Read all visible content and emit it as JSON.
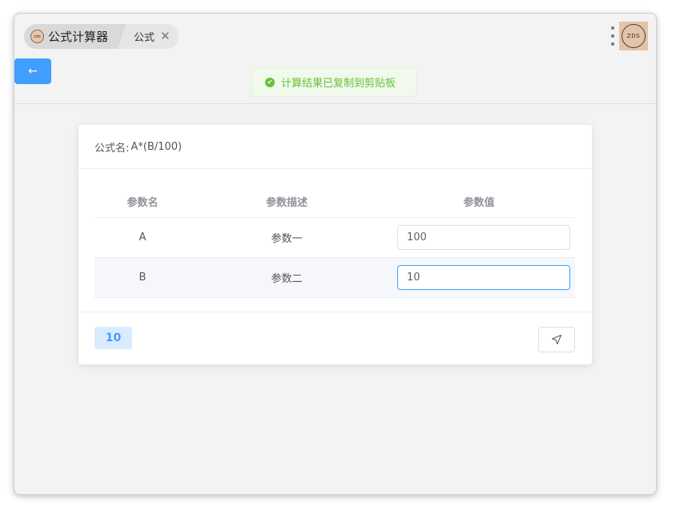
{
  "tabs": {
    "app_title": "公式计算器",
    "app_logo_text": "zds",
    "formula_tab": "公式",
    "close_glyph": "✕"
  },
  "header": {
    "avatar_text": "ZDS",
    "back_glyph": "←"
  },
  "toast": {
    "message": "计算结果已复制到剪贴板",
    "icon_glyph": "✔"
  },
  "card": {
    "formula_label": "公式名:",
    "formula_value": "A*(B/100)",
    "columns": {
      "name": "参数名",
      "description": "参数描述",
      "value": "参数值"
    },
    "params": [
      {
        "name": "A",
        "description": "参数一",
        "value": "100"
      },
      {
        "name": "B",
        "description": "参数二",
        "value": "10"
      }
    ],
    "result": "10"
  },
  "colors": {
    "primary": "#409eff",
    "success": "#67c23a"
  }
}
